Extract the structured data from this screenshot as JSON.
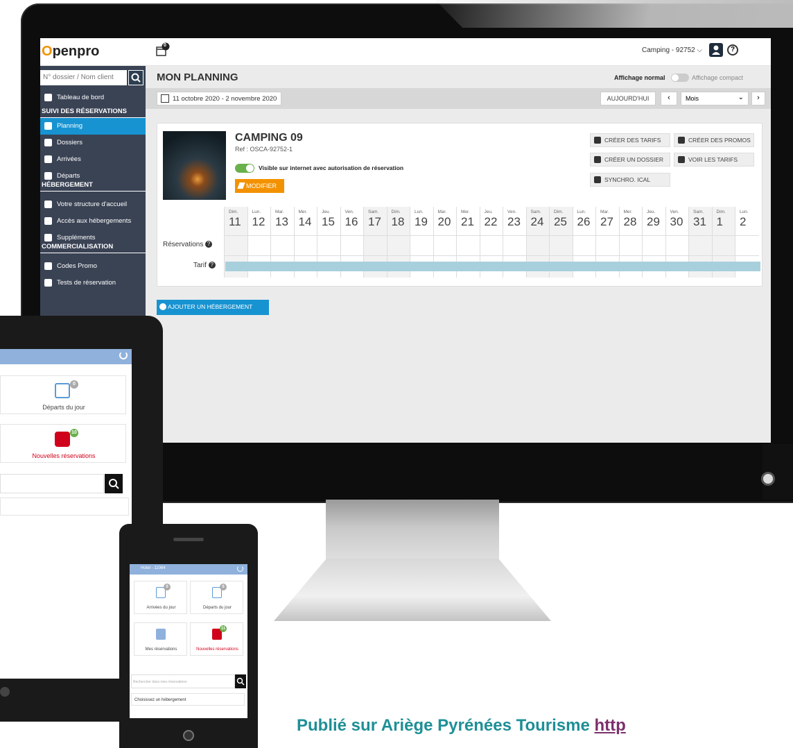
{
  "app": {
    "logo_o": "O",
    "logo_rest": "penpro",
    "notif_count": "0",
    "site_selector": "Camping - 92752",
    "help_glyph": "?"
  },
  "sidebar": {
    "search_placeholder": "N° dossier / Nom client",
    "items": [
      {
        "label": "Tableau de bord",
        "icon": "dashboard-icon"
      },
      {
        "header": "SUIVI DES RÉSERVATIONS"
      },
      {
        "label": "Planning",
        "icon": "calendar-icon",
        "active": true
      },
      {
        "label": "Dossiers",
        "icon": "search-icon"
      },
      {
        "label": "Arrivées",
        "icon": "arrival-icon"
      },
      {
        "label": "Départs",
        "icon": "departure-icon"
      },
      {
        "header": "HÉBERGEMENT"
      },
      {
        "label": "Votre structure d'accueil",
        "icon": "building-icon"
      },
      {
        "label": "Accès aux hébergements",
        "icon": "key-icon"
      },
      {
        "label": "Suppléments",
        "icon": "list-icon"
      },
      {
        "header": "COMMERCIALISATION"
      },
      {
        "label": "Codes Promo",
        "icon": "percent-icon"
      },
      {
        "label": "Tests de réservation",
        "icon": "play-icon"
      }
    ]
  },
  "main": {
    "title": "MON PLANNING",
    "display_normal": "Affichage normal",
    "display_compact": "Affichage compact",
    "date_range": "11 octobre 2020 - 2 novembre 2020",
    "today_label": "AUJOURD'HUI",
    "prev_glyph": "‹",
    "next_glyph": "›",
    "mode": "Mois",
    "mode_chevron": "⌄"
  },
  "card": {
    "title": "CAMPING 09",
    "ref": "Ref : OSCA-92752-1",
    "visible_text": "Visible sur internet avec autorisation de réservation",
    "modify_label": "MODIFIER",
    "actions": {
      "create_tariffs": "CRÉER DES TARIFS",
      "create_promos": "CRÉER DES PROMOS",
      "create_file": "CRÉER UN DOSSIER",
      "view_tariffs": "VOIR LES TARIFS",
      "sync_ical": "SYNCHRO. ICAL"
    },
    "row_reservations": "Réservations",
    "row_tarif": "Tarif",
    "days": [
      {
        "dn": "Dim.",
        "dd": "11",
        "we": true
      },
      {
        "dn": "Lun.",
        "dd": "12"
      },
      {
        "dn": "Mar.",
        "dd": "13"
      },
      {
        "dn": "Mer.",
        "dd": "14"
      },
      {
        "dn": "Jeu.",
        "dd": "15"
      },
      {
        "dn": "Ven.",
        "dd": "16"
      },
      {
        "dn": "Sam.",
        "dd": "17",
        "we": true
      },
      {
        "dn": "Dim.",
        "dd": "18",
        "we": true
      },
      {
        "dn": "Lun.",
        "dd": "19"
      },
      {
        "dn": "Mar.",
        "dd": "20"
      },
      {
        "dn": "Mer.",
        "dd": "21"
      },
      {
        "dn": "Jeu.",
        "dd": "22"
      },
      {
        "dn": "Ven.",
        "dd": "23"
      },
      {
        "dn": "Sam.",
        "dd": "24",
        "we": true
      },
      {
        "dn": "Dim.",
        "dd": "25",
        "we": true
      },
      {
        "dn": "Lun.",
        "dd": "26"
      },
      {
        "dn": "Mar.",
        "dd": "27"
      },
      {
        "dn": "Mer.",
        "dd": "28"
      },
      {
        "dn": "Jeu.",
        "dd": "29"
      },
      {
        "dn": "Ven.",
        "dd": "30"
      },
      {
        "dn": "Sam.",
        "dd": "31",
        "we": true
      },
      {
        "dn": "Dim.",
        "dd": "1",
        "we": true
      },
      {
        "dn": "Lun.",
        "dd": "2"
      }
    ],
    "add_label": "AJOUTER UN HÉBERGEMENT"
  },
  "tablet": {
    "tile_departs": "Départs du jour",
    "tile_departs_badge": "0",
    "tile_new": "Nouvelles réservations",
    "tile_new_badge": "10"
  },
  "phone": {
    "header": "Hotel - 11064",
    "arrivals": "Arrivées du jour",
    "arrivals_badge": "0",
    "departs": "Départs du jour",
    "departs_badge": "0",
    "mine": "Mes réservations",
    "new": "Nouvelles réservations",
    "new_badge": "11",
    "search_placeholder": "Rechercher dans mes réservations",
    "choose": "Choisissez un hébergement"
  },
  "footer": {
    "text": "Publié sur Ariège Pyrénées Tourisme ",
    "link": "http"
  },
  "colors": {
    "accent": "#1793d1",
    "sidebar": "#3a4354",
    "orange": "#f39200",
    "tarif_bar": "#a8d0dc",
    "footer_text": "#1e8f96"
  }
}
